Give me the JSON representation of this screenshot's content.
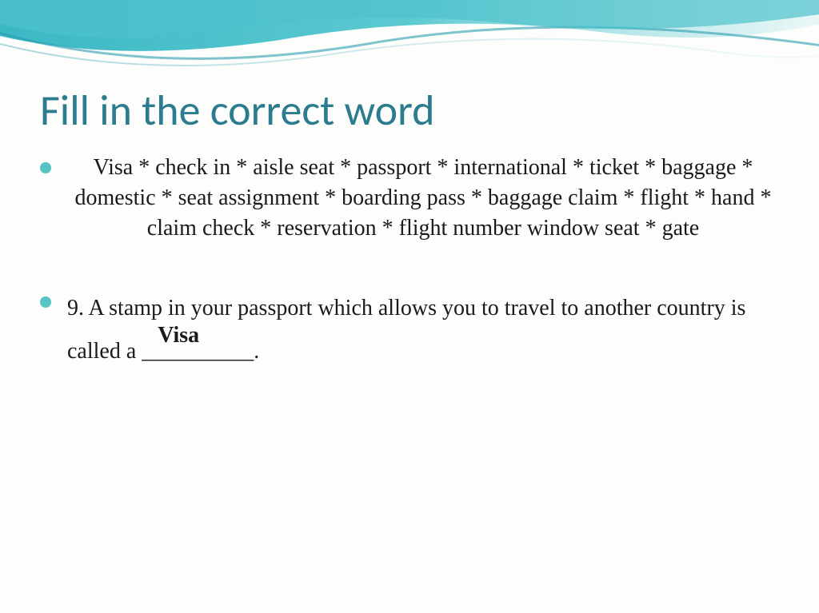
{
  "title": "Fill in the correct word",
  "wordBank": "Visa * check in * aisle seat * passport * international * ticket * baggage * domestic * seat assignment * boarding pass * baggage claim * flight * hand * claim check * reservation * flight number window seat * gate",
  "question": {
    "number": "9.",
    "textBefore": "A stamp in your passport which allows you to travel to another country is called a",
    "answer": "Visa",
    "blank": "__________",
    "punctuation": "."
  }
}
